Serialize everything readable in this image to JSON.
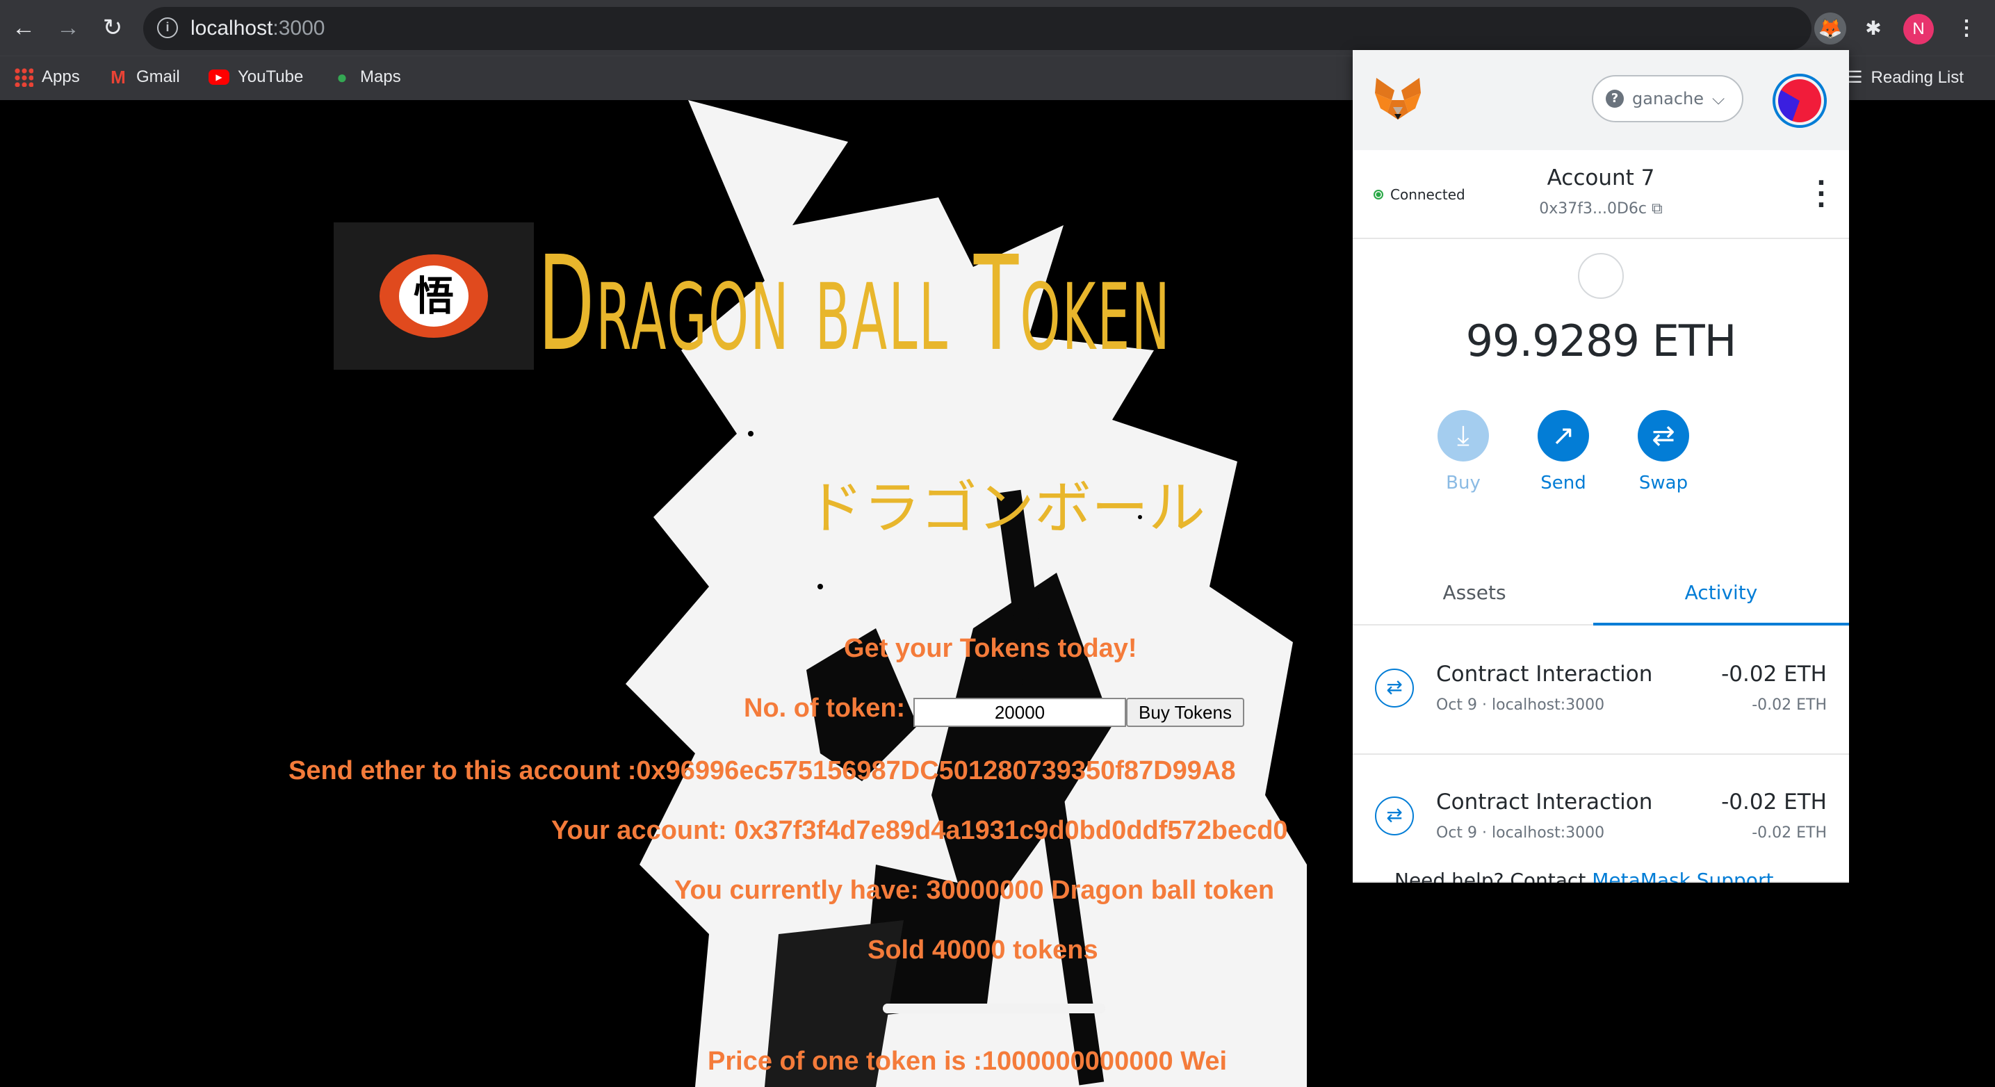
{
  "browser": {
    "url_host": "localhost",
    "url_port": ":3000",
    "profile_initial": "N",
    "bookmarks": [
      {
        "label": "Apps",
        "icon": "apps-grid-icon"
      },
      {
        "label": "Gmail",
        "icon": "gmail-icon"
      },
      {
        "label": "YouTube",
        "icon": "youtube-icon"
      },
      {
        "label": "Maps",
        "icon": "maps-pin-icon"
      }
    ],
    "reading_list": "Reading List"
  },
  "page": {
    "title": "Dragon ball Token",
    "jp_title": "ドラゴンボール",
    "logo_glyph": "悟",
    "get_tokens": "Get your Tokens today!",
    "token_label": "No. of token:",
    "token_value": "20000",
    "buy_button": "Buy Tokens",
    "send_ether": "Send ether to this account :0x96996ec575156987DC501280739350f87D99A8",
    "your_account": "Your account: 0x37f3f4d7e89d4a1931c9d0bd0ddf572becd0",
    "you_have": "You currently have: 30000000 Dragon ball token",
    "sold": "Sold 40000 tokens",
    "price": "Price of one token is :1000000000000 Wei",
    "accent_color": "#f47b3a",
    "title_color": "#e8b62c"
  },
  "metamask": {
    "network": "ganache",
    "status": "Connected",
    "account_name": "Account 7",
    "account_address": "0x37f3...0D6c",
    "balance": "99.9289 ETH",
    "actions": [
      {
        "label": "Buy",
        "icon": "download-arrow-icon"
      },
      {
        "label": "Send",
        "icon": "send-arrow-icon"
      },
      {
        "label": "Swap",
        "icon": "swap-arrows-icon"
      }
    ],
    "tabs": {
      "assets": "Assets",
      "activity": "Activity"
    },
    "transactions": [
      {
        "title": "Contract Interaction",
        "subtitle": "Oct 9 · localhost:3000",
        "amount": "-0.02 ETH",
        "amount_secondary": "-0.02 ETH"
      },
      {
        "title": "Contract Interaction",
        "subtitle": "Oct 9 · localhost:3000",
        "amount": "-0.02 ETH",
        "amount_secondary": "-0.02 ETH"
      }
    ],
    "help_text": "Need help? Contact ",
    "help_link": "MetaMask Support",
    "brand_color": "#037dd6"
  }
}
